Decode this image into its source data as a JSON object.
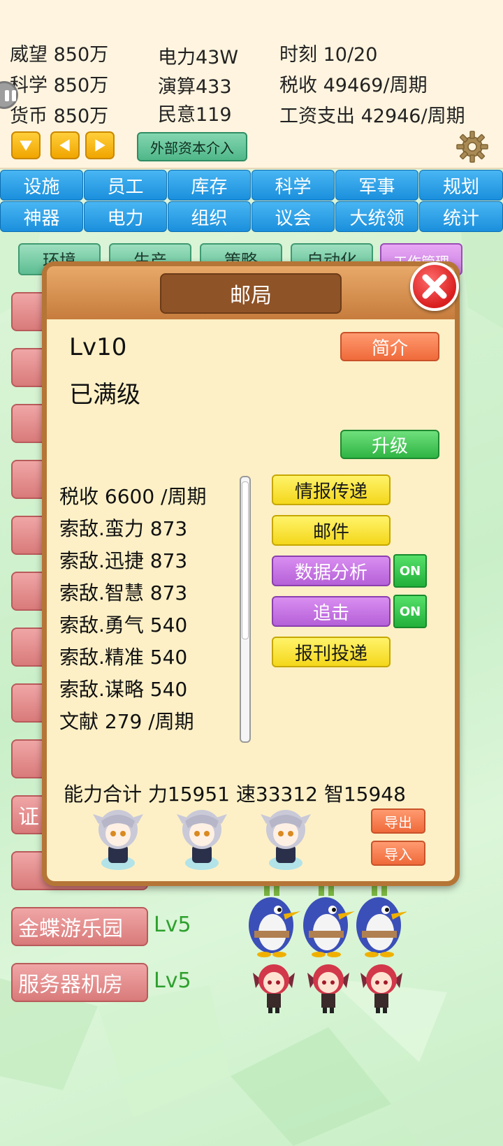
{
  "status": {
    "prestige": "威望 850万",
    "science": "科学 850万",
    "currency": "货币 850万",
    "power": "电力43W",
    "compute": "演算433",
    "opinion": "民意119",
    "time": "时刻 10/20",
    "tax": "税收 49469/周期",
    "wages": "工资支出 42946/周期",
    "capital_button": "外部资本介入"
  },
  "tabs": [
    "设施",
    "员工",
    "库存",
    "科学",
    "军事",
    "规划",
    "神器",
    "电力",
    "组织",
    "议会",
    "大统领",
    "统计"
  ],
  "subtabs": [
    "环境",
    "生产",
    "策略",
    "自动化",
    "工作管理"
  ],
  "facilities": [
    {
      "label": "证",
      "level": ""
    },
    {
      "label": "金蝶游乐园",
      "level": "Lv5"
    },
    {
      "label": "服务器机房",
      "level": "Lv5"
    }
  ],
  "dialog": {
    "title": "邮局",
    "level": "Lv10",
    "max_text": "已满级",
    "intro_button": "简介",
    "upgrade_button": "升级",
    "stats": [
      "税收 6600 /周期",
      "索敌.蛮力 873",
      "索敌.迅捷 873",
      "索敌.智慧 873",
      "索敌.勇气 540",
      "索敌.精准 540",
      "索敌.谋略 540",
      "文献 279 /周期"
    ],
    "actions": {
      "intel": "情报传递",
      "mail": "邮件",
      "analysis": "数据分析",
      "chase": "追击",
      "newspaper": "报刊投递",
      "on_label": "ON"
    },
    "ability_total": "能力合计 力15951 速33312 智15948",
    "export_button": "导出",
    "import_button": "导入"
  },
  "colors": {
    "tab_blue": "#1a8fdc",
    "dialog_bg": "#fdf0c6",
    "dialog_border": "#b57536",
    "level_green": "#2ea02e"
  }
}
